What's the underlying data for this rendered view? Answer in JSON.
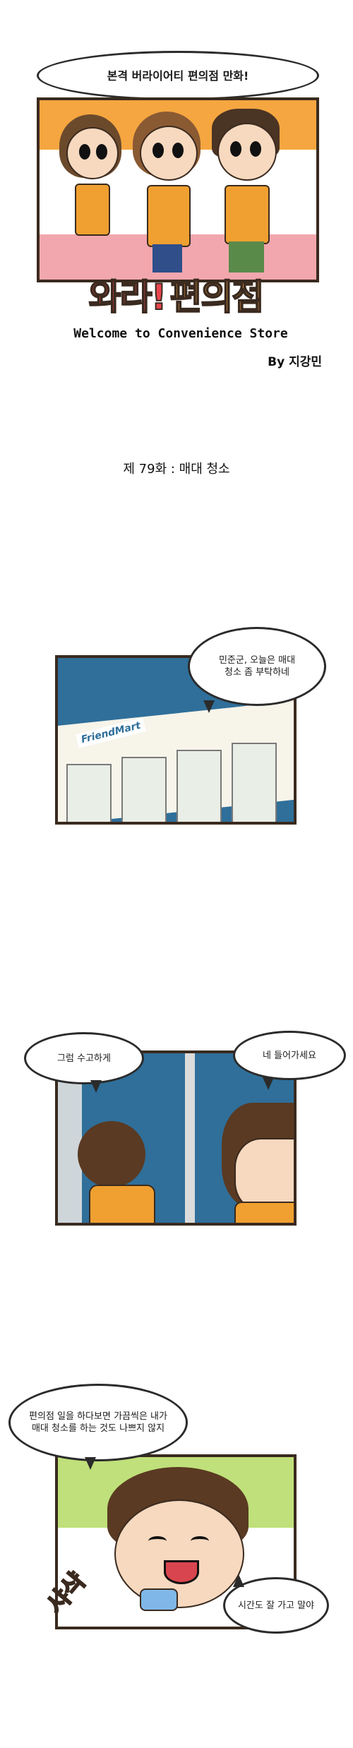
{
  "title_bubble": "본격 버라이어티 편의점 만화!",
  "logo": {
    "part1": "와라!",
    "part2": "편의점"
  },
  "subtitle": "Welcome to Convenience Store",
  "byline": "By 지강민",
  "episode": "제 79화 : 매대 청소",
  "store_sign": "FriendMart",
  "panel1_bubble": "민준군, 오늘은 매대 청소 좀 부탁하네",
  "panel2_bubble_left": "그럼 수고하게",
  "panel2_bubble_right": "네 들어가세요",
  "panel3_bubble_top": "편의점 일을 하다보면 가끔씩은 내가 매대 청소를 하는 것도 나쁘지 않지",
  "panel3_bubble_bottom": "시간도 잘 가고 말야",
  "sfx": "샤샥",
  "colors": {
    "frame": "#3a2a1f",
    "orange": "#f0a030",
    "pink": "#f2a7ae",
    "blue": "#2f6f9a",
    "green": "#bfe07a",
    "red": "#e8454e"
  }
}
